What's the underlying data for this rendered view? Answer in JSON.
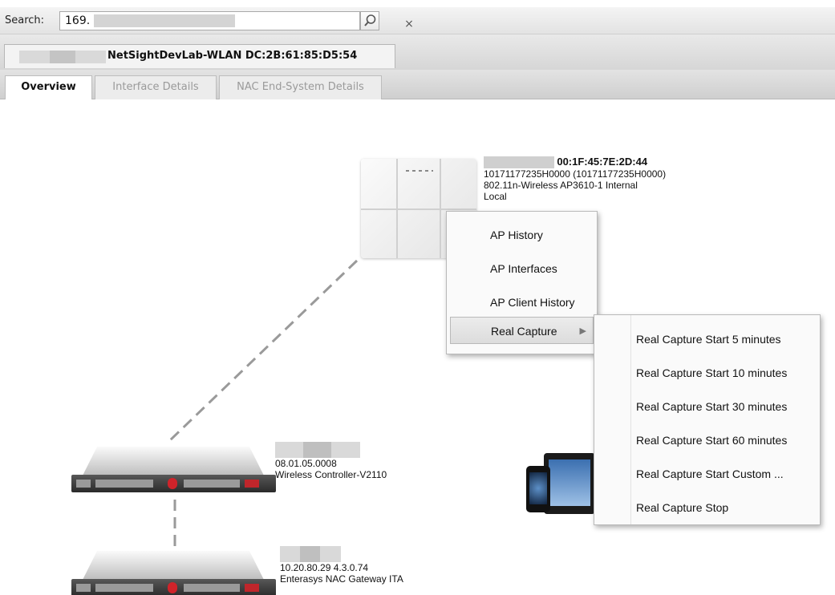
{
  "search": {
    "label": "Search:",
    "value": "169.",
    "clear_glyph": "×"
  },
  "device_tab": {
    "title": "NetSightDevLab-WLAN DC:2B:61:85:D5:54"
  },
  "view_tabs": [
    {
      "label": "Overview",
      "active": true
    },
    {
      "label": "Interface Details",
      "active": false
    },
    {
      "label": "NAC End-System Details",
      "active": false
    }
  ],
  "ap": {
    "mac": "00:1F:45:7E:2D:44",
    "serial": "10171177235H0000 (10171177235H0000)",
    "model": "802.11n-Wireless AP3610-1 Internal",
    "mode": "Local"
  },
  "controller": {
    "version": "08.01.05.0008",
    "model": "Wireless Controller-V2110"
  },
  "gateway": {
    "address": "10.20.80.29 4.3.0.74",
    "model": "Enterasys NAC Gateway ITA"
  },
  "context_menu": {
    "items": [
      {
        "label": "AP History"
      },
      {
        "label": "AP Interfaces"
      },
      {
        "label": "AP Client History"
      },
      {
        "label": "Real Capture",
        "has_submenu": true
      }
    ],
    "submenu_arrow": "▶"
  },
  "submenu": {
    "items": [
      {
        "label": "Real Capture Start 5 minutes"
      },
      {
        "label": "Real Capture Start 10 minutes"
      },
      {
        "label": "Real Capture Start 30 minutes"
      },
      {
        "label": "Real Capture Start 60 minutes"
      },
      {
        "label": "Real Capture Start Custom ..."
      },
      {
        "label": "Real Capture Stop"
      }
    ]
  },
  "colors": {
    "link_dash": "#9a9a9a",
    "server_red": "#d0232a"
  },
  "icons": [
    "search-icon",
    "clear-icon",
    "access-point-icon",
    "controller-server-icon",
    "gateway-server-icon",
    "mobile-devices-icon",
    "submenu-arrow-icon"
  ]
}
